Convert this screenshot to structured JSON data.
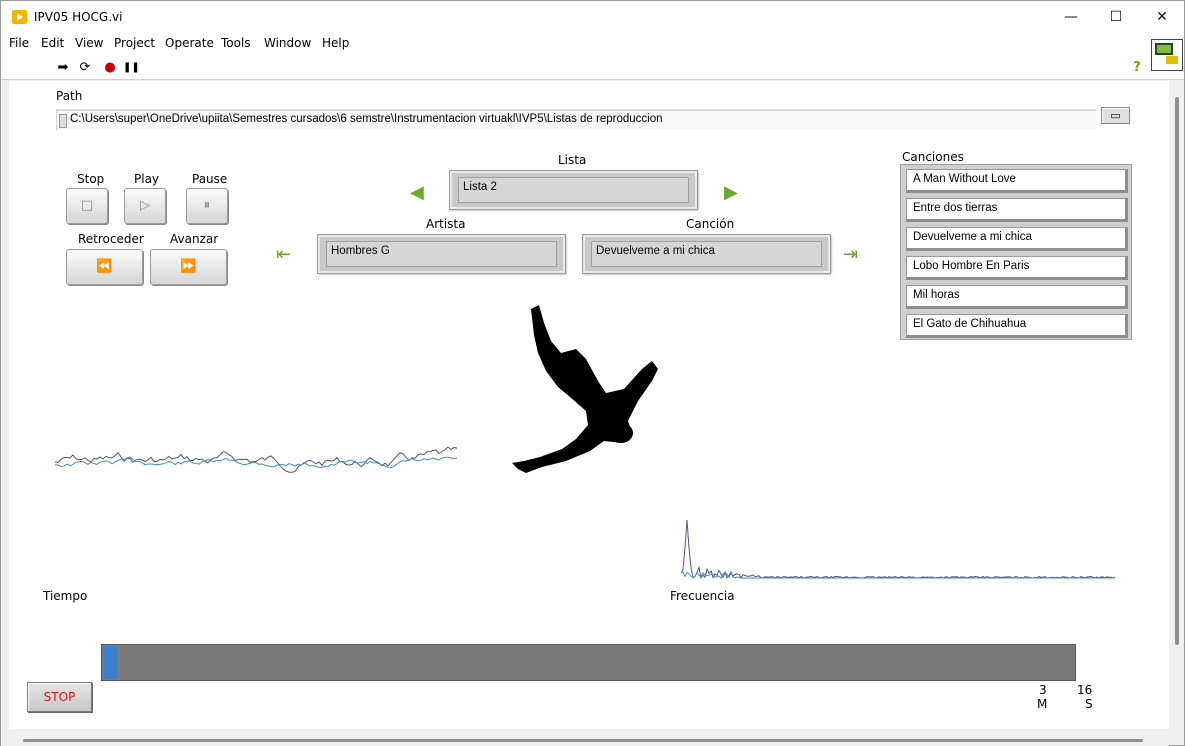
{
  "window": {
    "title": "IPV05 HOCG.vi",
    "minimize": "—",
    "maximize": "☐",
    "close": "✕"
  },
  "menu": [
    "File",
    "Edit",
    "View",
    "Project",
    "Operate",
    "Tools",
    "Window",
    "Help"
  ],
  "toolbar": {
    "run": "➡",
    "run_continuous": "⟳",
    "abort": "●",
    "pause": "❚❚",
    "help": "?"
  },
  "path": {
    "label": "Path",
    "value": "C:\\Users\\super\\OneDrive\\upiita\\Semestres cursados\\6 semstre\\Instrumentacion virtuakl\\IVP5\\Listas de reproduccion",
    "browse_glyph": "▭"
  },
  "controls": {
    "stop_label": "Stop",
    "play_label": "Play",
    "pause_label": "Pause",
    "rewind_label": "Retroceder",
    "forward_label": "Avanzar",
    "stop_glyph": "□",
    "play_glyph": "▷",
    "pause_glyph": "⏸",
    "rewind_glyph": "⏪",
    "forward_glyph": "⏩"
  },
  "lista": {
    "label": "Lista",
    "value": "Lista 2",
    "prev_glyph": "◀",
    "next_glyph": "▶"
  },
  "artista": {
    "label": "Artista",
    "value": "Hombres G",
    "prev_glyph": "⇤"
  },
  "cancion": {
    "label": "Canción",
    "value": "Devuelveme a mi chica",
    "next_glyph": "⇥"
  },
  "canciones": {
    "label": "Canciones",
    "items": [
      "A Man Without Love",
      "Entre dos tierras",
      "Devuelveme a mi chica",
      "Lobo Hombre En Paris",
      "Mil horas",
      "El Gato de Chihuahua"
    ]
  },
  "graphs": {
    "time_label": "Tiempo",
    "freq_label": "Frecuencia"
  },
  "playback": {
    "progress": 0.015,
    "minutes": "3",
    "minutes_unit": "M",
    "seconds": "16",
    "seconds_unit": "S"
  },
  "stop_button": "STOP",
  "colors": {
    "arrow_green": "#6aaa2a",
    "progress_blue": "#3a80d0",
    "stop_red": "#cc1a1a",
    "wave_dark": "#555566",
    "wave_blue": "#3b8fd0"
  }
}
